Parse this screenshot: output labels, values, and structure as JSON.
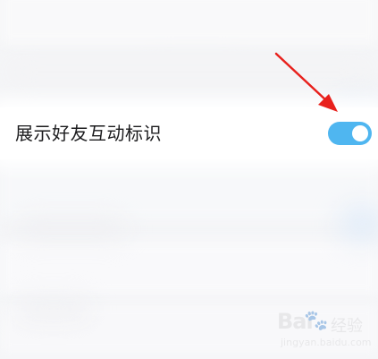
{
  "setting": {
    "label": "展示好友互动标识",
    "toggle_on": true
  },
  "watermark": {
    "brand": "Bai",
    "paw": "🐾",
    "jingyan": "经验",
    "url": "jingyan.baidu.com"
  },
  "colors": {
    "toggle_on": "#4fb6f0",
    "arrow": "#e8201c",
    "label_text": "#1c1c1e"
  },
  "icons": {
    "annotation": "red-arrow-icon"
  }
}
